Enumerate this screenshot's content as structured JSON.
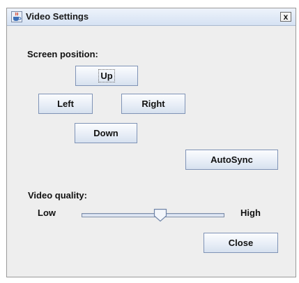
{
  "window": {
    "title": "Video Settings",
    "close_glyph": "x"
  },
  "screen_position": {
    "label": "Screen position:",
    "up": "Up",
    "left": "Left",
    "right": "Right",
    "down": "Down"
  },
  "autosync": {
    "label": "AutoSync"
  },
  "video_quality": {
    "label": "Video quality:",
    "low_label": "Low",
    "high_label": "High",
    "value_fraction": 0.55
  },
  "close_button": {
    "label": "Close"
  },
  "icons": {
    "app": "java-cup-icon",
    "close": "close-icon",
    "slider_thumb": "slider-thumb-icon"
  }
}
